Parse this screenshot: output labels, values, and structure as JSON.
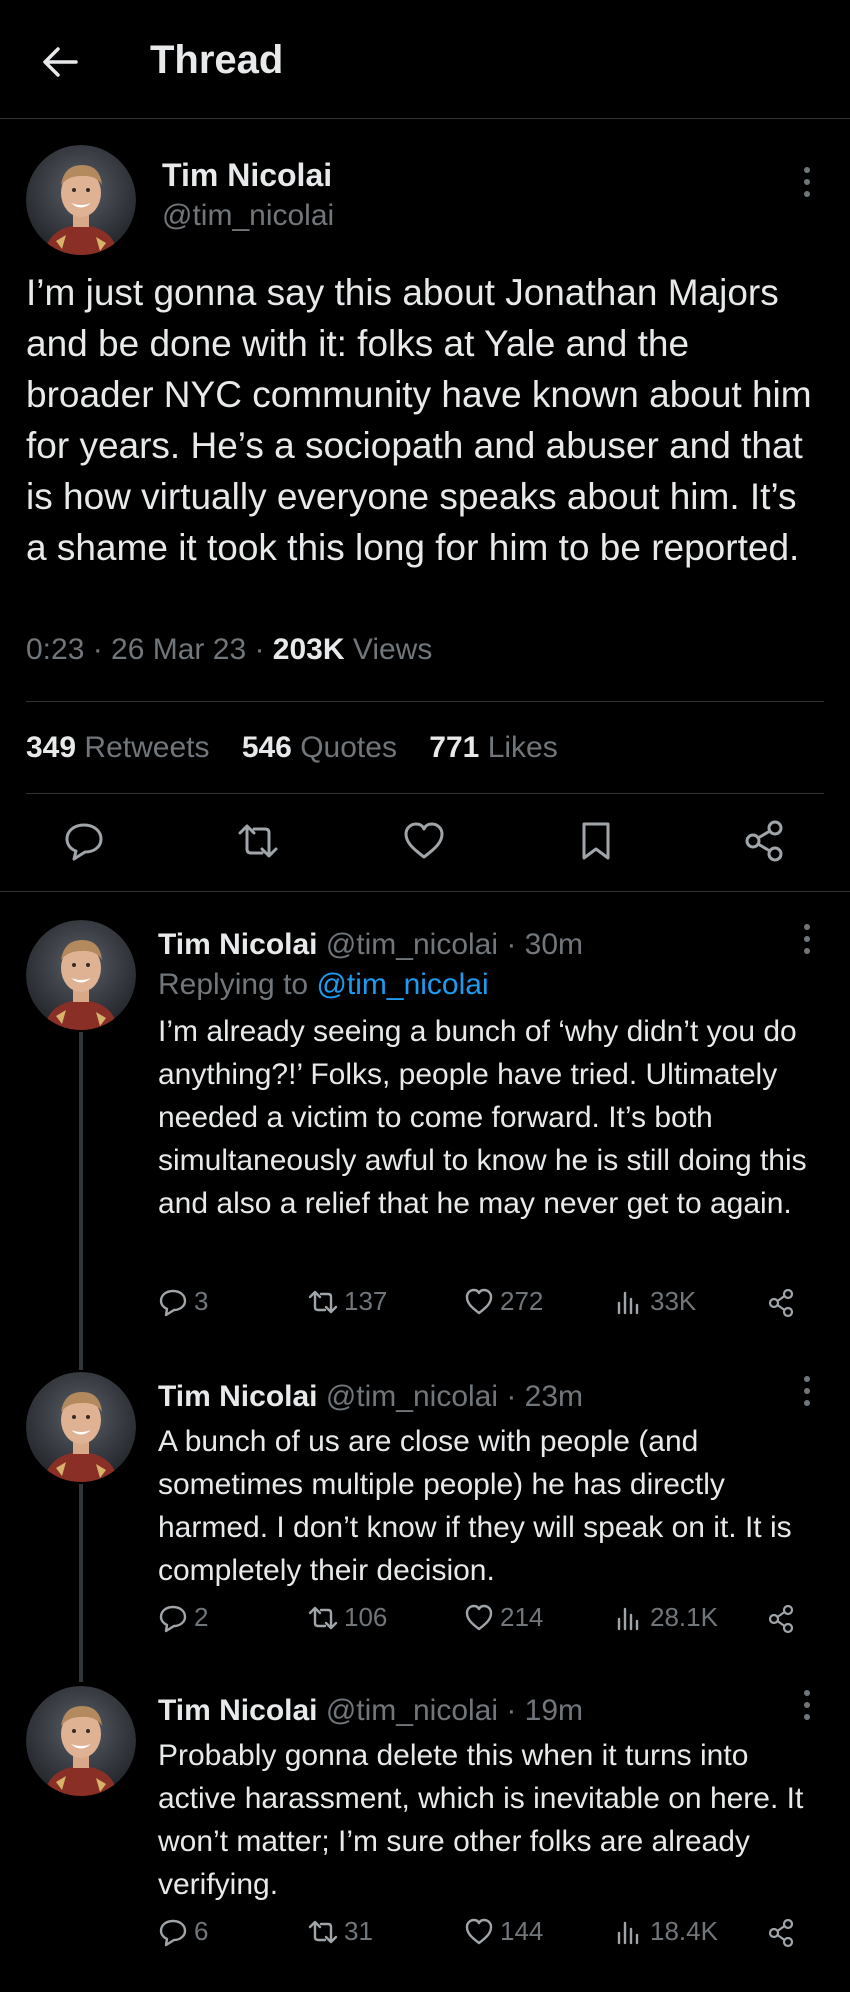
{
  "header": {
    "title": "Thread"
  },
  "main_tweet": {
    "name": "Tim Nicolai",
    "handle": "@tim_nicolai",
    "text": "I’m just gonna say this about Jonathan Majors and be done with it: folks at Yale and the broader NYC community have known about him for years. He’s a sociopath and abuser and that is how virtually everyone speaks about him. It’s a shame it took this long for him to be reported.",
    "time": "0:23 · 26 Mar 23 · ",
    "views": "203K",
    "views_label": " Views",
    "retweets": "349",
    "retweets_label": "Retweets",
    "quotes": "546",
    "quotes_label": "Quotes",
    "likes": "771",
    "likes_label": "Likes"
  },
  "replies": [
    {
      "name": "Tim Nicolai",
      "handle": "@tim_nicolai · 30m",
      "replying_prefix": "Replying to ",
      "replying_to": "@tim_nicolai",
      "text": "I’m already seeing a bunch of ‘why didn’t you do anything?!’ Folks, people have tried. Ultimately needed a victim to come forward. It’s both simultaneously awful to know he is still doing this and also a relief that he may never get to again.",
      "replies": "3",
      "retweets": "137",
      "likes": "272",
      "views": "33K"
    },
    {
      "name": "Tim Nicolai",
      "handle": "@tim_nicolai · 23m",
      "text": "A bunch of us are close with people (and sometimes multiple people) he has directly harmed. I don’t know if they will speak on it. It is completely their decision.",
      "replies": "2",
      "retweets": "106",
      "likes": "214",
      "views": "28.1K"
    },
    {
      "name": "Tim Nicolai",
      "handle": "@tim_nicolai · 19m",
      "text": "Probably gonna delete this when it turns into active harassment, which is inevitable on here. It won’t matter; I’m sure other folks are already verifying.",
      "replies": "6",
      "retweets": "31",
      "likes": "144",
      "views": "18.4K"
    }
  ],
  "colors": {
    "background": "#000000",
    "text": "#e7e9ea",
    "muted": "#71767b",
    "link": "#1d9bf0",
    "border": "#2f3336"
  }
}
